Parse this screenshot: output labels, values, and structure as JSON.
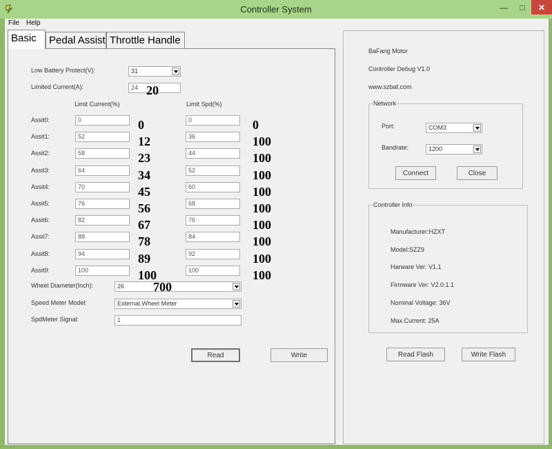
{
  "window": {
    "title": "Controller System"
  },
  "menu": {
    "file": "File",
    "help": "Help"
  },
  "tabs": [
    {
      "label": "Basic"
    },
    {
      "label": "Pedal Assist"
    },
    {
      "label": "Throttle Handle"
    }
  ],
  "basic": {
    "low_battery": {
      "label": "Low Battery Protect(V):",
      "value": "31"
    },
    "limited_current": {
      "label": "Limited Current(A):",
      "value": "24",
      "annotation": "20"
    },
    "headers": {
      "current": "Limit Current(%)",
      "speed": "Limit Spd(%)"
    },
    "assists": [
      {
        "label": "Assit0:",
        "current": "0",
        "current_note": "0",
        "speed": "0",
        "speed_note": "0"
      },
      {
        "label": "Assit1:",
        "current": "52",
        "current_note": "12",
        "speed": "36",
        "speed_note": "100"
      },
      {
        "label": "Assit2:",
        "current": "58",
        "current_note": "23",
        "speed": "44",
        "speed_note": "100"
      },
      {
        "label": "Assit3:",
        "current": "64",
        "current_note": "34",
        "speed": "52",
        "speed_note": "100"
      },
      {
        "label": "Assit4:",
        "current": "70",
        "current_note": "45",
        "speed": "60",
        "speed_note": "100"
      },
      {
        "label": "Assit5:",
        "current": "76",
        "current_note": "56",
        "speed": "68",
        "speed_note": "100"
      },
      {
        "label": "Assit6:",
        "current": "82",
        "current_note": "67",
        "speed": "76",
        "speed_note": "100"
      },
      {
        "label": "Assit7:",
        "current": "88",
        "current_note": "78",
        "speed": "84",
        "speed_note": "100"
      },
      {
        "label": "Assit8:",
        "current": "94",
        "current_note": "89",
        "speed": "92",
        "speed_note": "100"
      },
      {
        "label": "Assit9:",
        "current": "100",
        "current_note": "100",
        "speed": "100",
        "speed_note": "100"
      }
    ],
    "wheel_diameter": {
      "label": "Wheel Diameter(Inch):",
      "value": "26",
      "annotation": "700"
    },
    "speed_meter_model": {
      "label": "Speed Meter Model:",
      "value": "External,Wheel Meter"
    },
    "spd_meter_signal": {
      "label": "SpdMeter Signal:",
      "value": "1"
    },
    "read_button": "Read",
    "write_button": "Write"
  },
  "info": {
    "brand": "BaFang Motor",
    "version": "Controller Debug V1.0",
    "website": "www.szbaf.com"
  },
  "network": {
    "legend": "Network",
    "port": {
      "label": "Port:",
      "value": "COM3"
    },
    "bandrate": {
      "label": "Bandrate:",
      "value": "1200"
    },
    "connect_button": "Connect",
    "close_button": "Close"
  },
  "controller_info": {
    "legend": "Controller Info",
    "manufacturer": "Manufacturer:HZXT",
    "model": "Model:SZZ9",
    "hardware": "Harware Ver: V1.1",
    "firmware": "Firmware Ver: V2.0.1.1",
    "voltage": "Nominal Voltage: 36V",
    "current": "Max.Current: 25A"
  },
  "flash": {
    "read": "Read Flash",
    "write": "Write Flash"
  }
}
